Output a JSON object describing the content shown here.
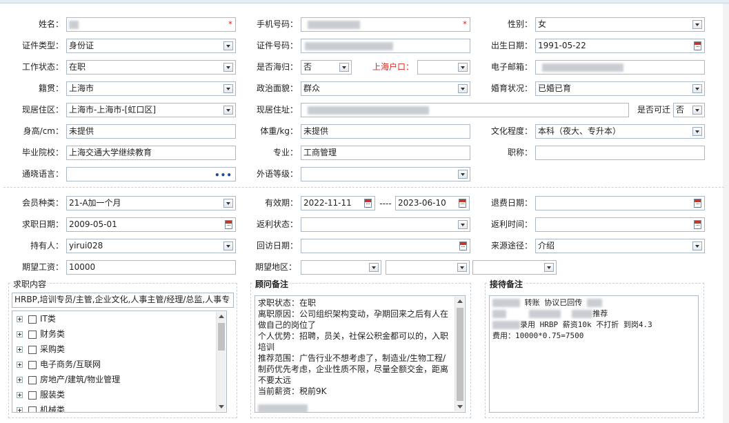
{
  "form": {
    "name": {
      "label": "姓名：",
      "value": ""
    },
    "phone": {
      "label": "手机号码：",
      "value": ""
    },
    "gender": {
      "label": "性别：",
      "value": "女"
    },
    "id_type": {
      "label": "证件类型：",
      "value": "身份证"
    },
    "id_number": {
      "label": "证件号码：",
      "value": ""
    },
    "birth_date": {
      "label": "出生日期：",
      "value": "1991-05-22"
    },
    "work_status": {
      "label": "工作状态：",
      "value": "在职"
    },
    "returnee": {
      "label": "是否海归：",
      "value": "否"
    },
    "shanghai_hukou": {
      "label": "上海户口：",
      "value": ""
    },
    "email": {
      "label": "电子邮箱：",
      "value": ""
    },
    "native_place": {
      "label": "籍贯：",
      "value": "上海市"
    },
    "political": {
      "label": "政治面貌：",
      "value": "群众"
    },
    "marital": {
      "label": "婚育状况：",
      "value": "已婚已育"
    },
    "residence_area": {
      "label": "现居住区：",
      "value": "上海市-上海市-[虹口区]"
    },
    "residence_address": {
      "label": "现居住址：",
      "value": ""
    },
    "relocate": {
      "label": "是否可迁",
      "value": "否"
    },
    "height": {
      "label": "身高/cm：",
      "value": "未提供"
    },
    "weight": {
      "label": "体重/kg：",
      "value": "未提供"
    },
    "education": {
      "label": "文化程度：",
      "value": "本科（夜大、专升本）"
    },
    "school": {
      "label": "毕业院校：",
      "value": "上海交通大学继续教育"
    },
    "major": {
      "label": "专业：",
      "value": "工商管理"
    },
    "title": {
      "label": "职称：",
      "value": ""
    },
    "language": {
      "label": "通晓语言：",
      "value": ""
    },
    "foreign_level": {
      "label": "外语等级：",
      "value": ""
    }
  },
  "member": {
    "type": {
      "label": "会员种类：",
      "value": "21-A加一个月"
    },
    "validity": {
      "label": "有效期：",
      "start": "2022-11-11",
      "sep": "----",
      "end": "2023-06-10"
    },
    "refund_date": {
      "label": "退费日期：",
      "value": ""
    },
    "apply_date": {
      "label": "求职日期：",
      "value": "2009-05-01"
    },
    "rebate_status": {
      "label": "返利状态：",
      "value": ""
    },
    "rebate_time": {
      "label": "返利时间：",
      "value": ""
    },
    "holder": {
      "label": "持有人：",
      "value": "yirui028"
    },
    "revisit_date": {
      "label": "回访日期：",
      "value": ""
    },
    "source": {
      "label": "来源途径：",
      "value": "介绍"
    },
    "salary": {
      "label": "期望工资：",
      "value": "10000"
    },
    "region": {
      "label": "期望地区：",
      "value": ""
    }
  },
  "job_content": {
    "title": "求职内容",
    "summary": "HRBP,培训专员/主管,企业文化,人事主管/经理/总监,人事专",
    "categories": [
      "IT类",
      "财务类",
      "采购类",
      "电子商务/互联网",
      "房地产/建筑/物业管理",
      "服装类",
      "机械类"
    ]
  },
  "advisor_notes": {
    "title": "顾问备注",
    "lines": [
      "求职状态：在职",
      "离职原因：公司组织架构变动，孕期回来之后有人在做自己的岗位了",
      "个人优势：招聘，员关，社保公积金都可以的，入职培训",
      "推荐范围：广告行业不想考虑了，制造业/生物工程/制药优先考虑，企业性质不限，尽量全额交金，距离不要太远",
      "当前薪资：税前9K"
    ]
  },
  "reception_notes": {
    "title": "接待备注",
    "line1": "转账 协议已回传",
    "line2": "推荐",
    "line3": "录用 HRBP 薪资10k 不打折 到岗4.3",
    "line4": "费用：10000*0.75=7500"
  },
  "colors": {
    "border": "#a9b7c7",
    "required": "#e0261f",
    "hukou_label": "#e0261f"
  }
}
